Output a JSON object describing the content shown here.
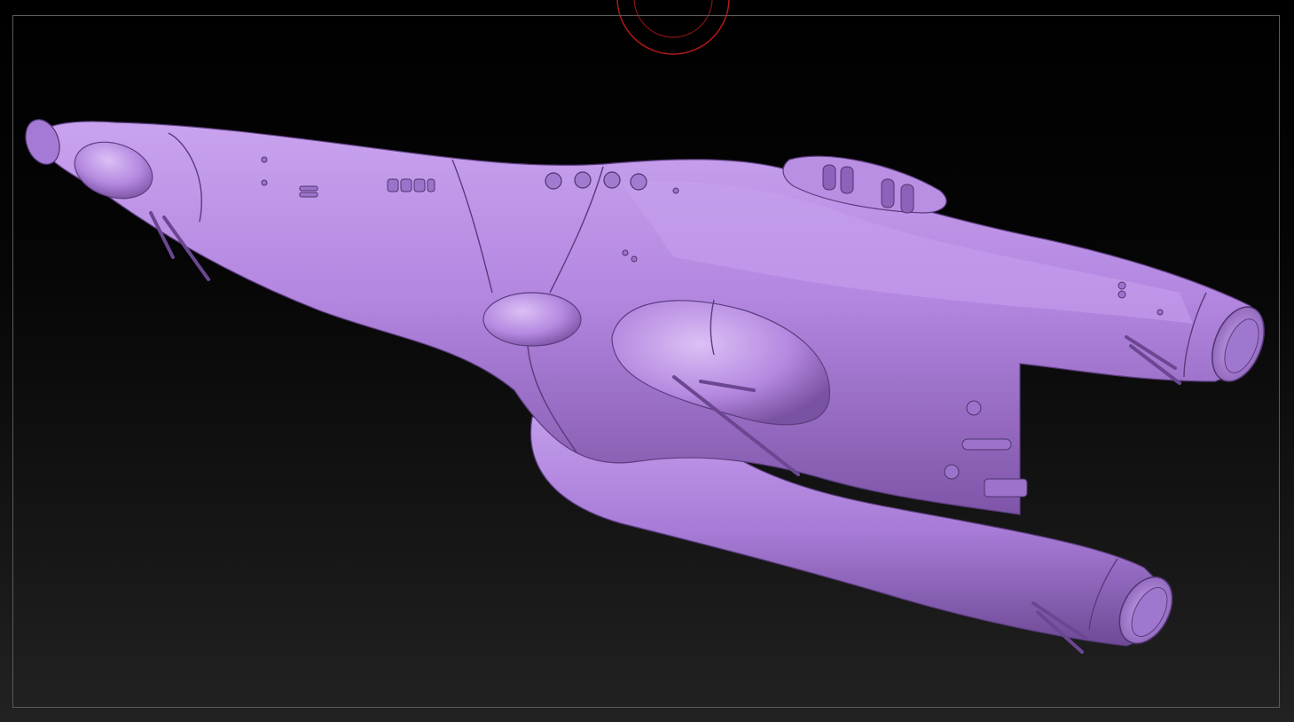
{
  "viewport": {
    "background_top": "#000000",
    "background_bottom": "#222222",
    "frame_color": "#5a5a5a"
  },
  "brush": {
    "icon": "brush-radius-circle-icon",
    "color": "#b01818"
  },
  "model": {
    "material_color": "#b58ae0",
    "shadow_color": "#6f4b95",
    "highlight_color": "#d7baf2"
  }
}
